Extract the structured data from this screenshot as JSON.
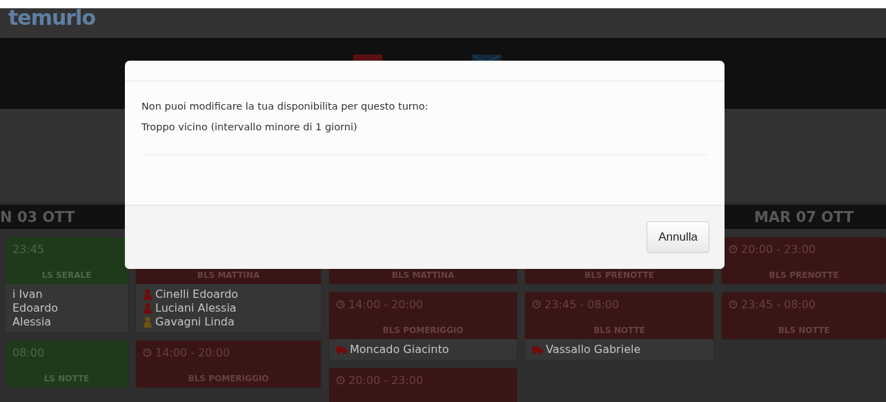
{
  "header": {
    "logo": "temurlo"
  },
  "days": [
    {
      "label": "N 03 OTT",
      "shifts": [
        {
          "time": "23:45",
          "label": "LS SERALE",
          "color": "#1f3a1b",
          "people": [
            {
              "name": "i Ivan"
            },
            {
              "name": "Edoardo"
            },
            {
              "name": "Alessia"
            }
          ]
        },
        {
          "time": "08:00",
          "label": "LS NOTTE",
          "color": "#1f3a1b"
        }
      ]
    },
    {
      "shifts": [
        {
          "label": "BLS MATTINA",
          "color": "#3a1515",
          "people": [
            {
              "name": "Cinelli Edoardo",
              "kind": "person",
              "color": "#6e0c0c"
            },
            {
              "name": "Luciani Alessia",
              "kind": "person",
              "color": "#6e0c0c"
            },
            {
              "name": "Gavagni Linda",
              "kind": "person",
              "color": "#6b5412"
            }
          ]
        },
        {
          "time": "14:00 - 20:00",
          "label": "BLS POMERIGGIO",
          "color": "#3a1515"
        }
      ]
    },
    {
      "shifts": [
        {
          "label": "BLS MATTINA",
          "color": "#3a1515"
        },
        {
          "time": "14:00 - 20:00",
          "label": "BLS POMERIGGIO",
          "color": "#3a1515",
          "people": [
            {
              "name": "Moncado Giacinto",
              "kind": "vehicle",
              "color": "#6e0c0c"
            }
          ]
        },
        {
          "time": "20:00 - 23:00",
          "color": "#3a1515"
        }
      ]
    },
    {
      "shifts": [
        {
          "label": "BLS PRENOTTE",
          "color": "#3a1515"
        },
        {
          "time": "23:45 - 08:00",
          "label": "BLS NOTTE",
          "color": "#3a1515",
          "people": [
            {
              "name": "Vassallo Gabriele",
              "kind": "vehicle",
              "color": "#6e0c0c"
            }
          ]
        }
      ]
    },
    {
      "label": "MAR 07 OTT",
      "shifts": [
        {
          "time": "20:00 - 23:00",
          "label": "BLS PRENOTTE",
          "color": "#3a1515"
        },
        {
          "time": "23:45 - 08:00",
          "label": "BLS NOTTE",
          "color": "#3a1515"
        }
      ]
    }
  ],
  "modal": {
    "message": [
      "Non puoi modificare la tua disponibilita per questo turno:",
      "Troppo vicino (intervallo minore di 1 giorni)"
    ],
    "buttons": [
      "Annulla"
    ]
  }
}
